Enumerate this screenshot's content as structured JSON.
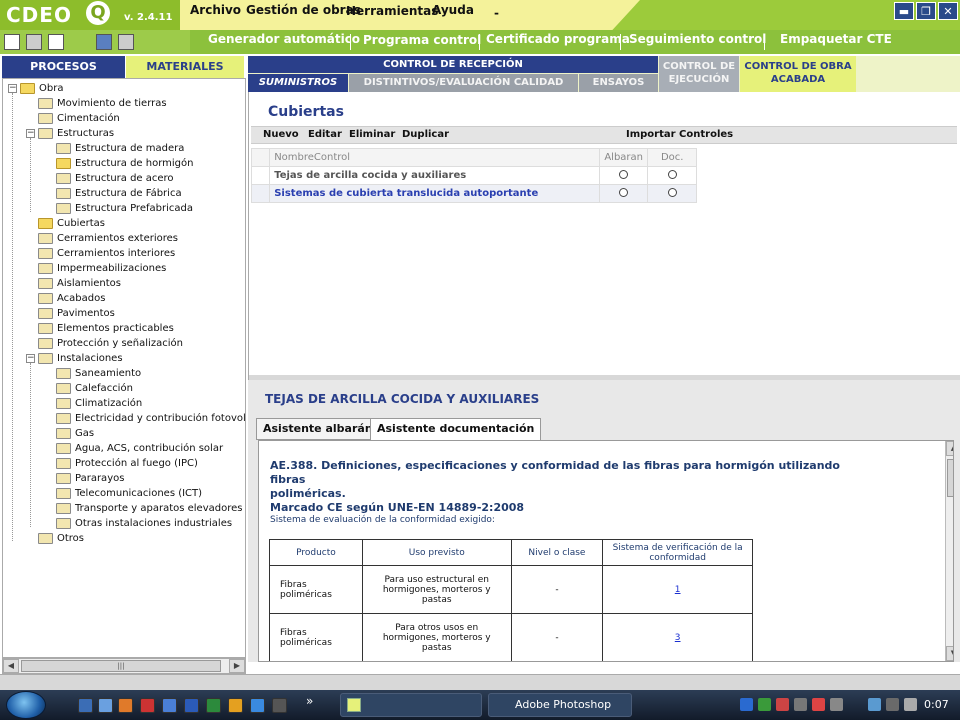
{
  "app": {
    "logo": "CDEO",
    "logo_q": "Q",
    "version": "v. 2.4.11"
  },
  "menu": {
    "archivo": "Archivo",
    "gestion": "Gestión de obras",
    "herramientas": "Herramientas",
    "ayuda": "Ayuda",
    "dash": "-"
  },
  "window_controls": {
    "minimize": "▬",
    "restore": "❐",
    "close": "✕"
  },
  "toolbar": {
    "generador": "Generador automático",
    "programa": "Programa control",
    "certificado": "Certificado programa",
    "seguimiento": "Seguimiento control",
    "empaquetar": "Empaquetar CTE"
  },
  "left_tabs": {
    "procesos": "PROCESOS",
    "materiales": "MATERIALES"
  },
  "tree": {
    "root": "Obra",
    "items": [
      {
        "label": "Movimiento de tierras"
      },
      {
        "label": "Cimentación"
      },
      {
        "label": "Estructuras"
      },
      {
        "label": "Estructura de madera"
      },
      {
        "label": "Estructura de hormigón"
      },
      {
        "label": "Estructura de acero"
      },
      {
        "label": "Estructura de Fábrica"
      },
      {
        "label": "Estructura Prefabricada"
      },
      {
        "label": "Cubiertas"
      },
      {
        "label": "Cerramientos exteriores"
      },
      {
        "label": "Cerramientos interiores"
      },
      {
        "label": "Impermeabilizaciones"
      },
      {
        "label": "Aislamientos"
      },
      {
        "label": "Acabados"
      },
      {
        "label": "Pavimentos"
      },
      {
        "label": "Elementos practicables"
      },
      {
        "label": "Protección y señalización"
      },
      {
        "label": "Instalaciones"
      },
      {
        "label": "Saneamiento"
      },
      {
        "label": "Calefacción"
      },
      {
        "label": "Climatización"
      },
      {
        "label": "Electricidad y contribución fotovoltaic"
      },
      {
        "label": "Gas"
      },
      {
        "label": "Agua, ACS, contribución solar"
      },
      {
        "label": "Protección al fuego (IPC)"
      },
      {
        "label": "Pararayos"
      },
      {
        "label": "Telecomunicaciones (ICT)"
      },
      {
        "label": "Transporte y aparatos elevadores"
      },
      {
        "label": "Otras instalaciones industriales"
      },
      {
        "label": "Otros"
      }
    ]
  },
  "right_tabs": {
    "control_recepcion": "CONTROL DE RECEPCIÓN",
    "suministros": "SUMINISTROS",
    "distintivos": "DISTINTIVOS/EVALUACIÓN CALIDAD",
    "ensayos": "ENSAYOS",
    "control_ejecucion_1": "CONTROL DE",
    "control_ejecucion_2": "EJECUCIÓN",
    "control_obra_1": "CONTROL DE OBRA",
    "control_obra_2": "ACABADA"
  },
  "section": {
    "title": "Cubiertas",
    "actions": {
      "nuevo": "Nuevo",
      "editar": "Editar",
      "eliminar": "Eliminar",
      "duplicar": "Duplicar",
      "importar": "Importar Controles"
    },
    "table": {
      "headers": {
        "nombre": "NombreControl",
        "albaran": "Albaran",
        "doc": "Doc."
      },
      "rows": [
        {
          "nombre": "Tejas de arcilla cocida y auxiliares"
        },
        {
          "nombre": "Sistemas de cubierta translucida autoportante"
        }
      ]
    }
  },
  "lower": {
    "title": "TEJAS DE ARCILLA COCIDA Y AUXILIARES",
    "tabs": {
      "albaran": "Asistente albarán",
      "documentacion": "Asistente documentación"
    },
    "doc": {
      "heading_line1": "AE.388. Definiciones, especificaciones y conformidad de las fibras para hormigón utilizando fibras",
      "heading_line2": "poliméricas.",
      "heading_line3": "Marcado CE según UNE-EN 14889-2:2008",
      "subtitle": "Sistema de evaluación de la conformidad exigido:",
      "table": {
        "headers": {
          "producto": "Producto",
          "uso": "Uso previsto",
          "nivel": "Nivel o clase",
          "sistema_1": "Sistema de verificación de la",
          "sistema_2": "conformidad"
        },
        "rows": [
          {
            "producto_1": "Fibras",
            "producto_2": "poliméricas",
            "uso_1": "Para uso estructural en",
            "uso_2": "hormigones, morteros y",
            "uso_3": "pastas",
            "nivel": "-",
            "sistema": "1"
          },
          {
            "producto_1": "Fibras",
            "producto_2": "poliméricas",
            "uso_1": "Para otros usos en",
            "uso_2": "hormigones, morteros y",
            "uso_3": "pastas",
            "nivel": "-",
            "sistema": "3"
          }
        ]
      }
    }
  },
  "taskbar": {
    "task_label": "Adobe Photoshop",
    "clock": "0:07",
    "more": "»"
  },
  "colors": {
    "green": "#9ccb3b",
    "lime": "#e6f17a",
    "navy": "#2a3f8a",
    "link": "#1a2fd0"
  }
}
